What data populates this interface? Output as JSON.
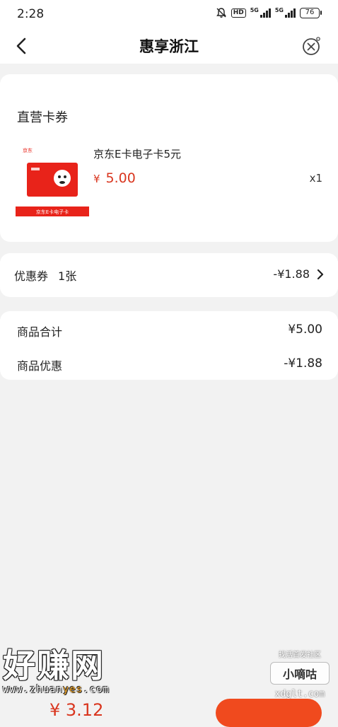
{
  "status_bar": {
    "time": "2:28",
    "hd_label": "HD",
    "signal_1_label": "5G",
    "signal_2_label": "5G",
    "battery": "76"
  },
  "nav": {
    "title": "惠享浙江",
    "back_icon": "chevron-left-icon",
    "close_icon": "close-circle-icon"
  },
  "items_card": {
    "section_title": "直营卡券",
    "product": {
      "name": "京东E卡电子卡5元",
      "currency": "¥",
      "price": "5.00",
      "quantity": "x1",
      "image": {
        "brand_text": "京东",
        "caption": "京东E卡电子卡",
        "card_color": "#e8231a"
      }
    }
  },
  "coupon": {
    "label": "优惠券",
    "count": "1张",
    "value": "-¥1.88"
  },
  "summary": {
    "rows": [
      {
        "label": "商品合计",
        "value": "¥5.00"
      },
      {
        "label": "商品优惠",
        "value": "-¥1.88"
      }
    ]
  },
  "watermark": {
    "left_big": "好赚网",
    "left_url_a": "www.zhuan",
    "left_url_b": "yes",
    "left_url_c": ".com",
    "right_top": "找活首发社区",
    "right_brand": "小嘀咕",
    "right_url": "xdglt.com"
  },
  "bottom_bar": {
    "total": "¥ 3.12"
  },
  "colors": {
    "accent": "#d9361f",
    "button": "#f04a1e",
    "page_bg": "#f2f2f2"
  }
}
